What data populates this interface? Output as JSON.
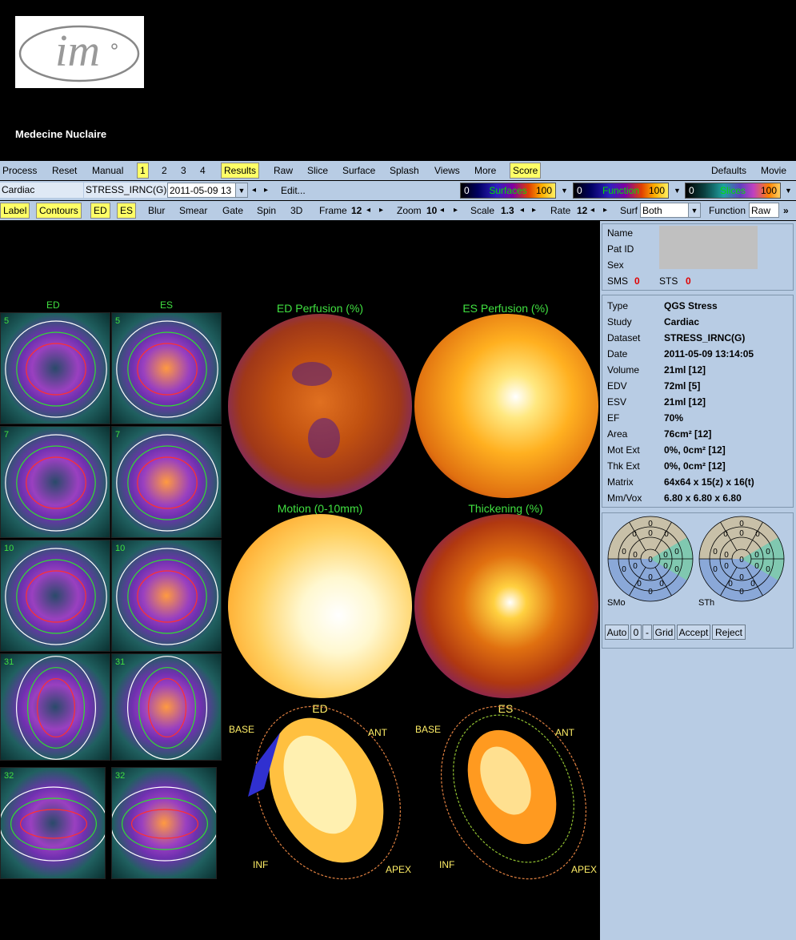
{
  "header": {
    "logo_text": "im",
    "subtitle": "Medecine Nuclaire"
  },
  "toolbar1": {
    "process": "Process",
    "reset": "Reset",
    "manual": "Manual",
    "page1": "1",
    "page2": "2",
    "page3": "3",
    "page4": "4",
    "results": "Results",
    "raw": "Raw",
    "slice": "Slice",
    "surface": "Surface",
    "splash": "Splash",
    "views": "Views",
    "more": "More",
    "score": "Score",
    "defaults": "Defaults",
    "movie": "Movie"
  },
  "toolbar2": {
    "app": "Cardiac",
    "dataset": "STRESS_IRNC(G)",
    "date": "2011-05-09 13",
    "edit": "Edit...",
    "surfaces": {
      "min": "0",
      "name": "Surfaces",
      "max": "100"
    },
    "function": {
      "min": "0",
      "name": "Function",
      "max": "100"
    },
    "slices": {
      "min": "0",
      "name": "Slices",
      "max": "100"
    }
  },
  "toolbar3": {
    "label": "Label",
    "contours": "Contours",
    "ed": "ED",
    "es": "ES",
    "blur": "Blur",
    "smear": "Smear",
    "gate": "Gate",
    "spin": "Spin",
    "threed": "3D",
    "frame_label": "Frame",
    "frame_val": "12",
    "zoom_label": "Zoom",
    "zoom_val": "10",
    "scale_label": "Scale",
    "scale_val": "1.3",
    "rate_label": "Rate",
    "rate_val": "12",
    "surf_label": "Surf",
    "surf_val": "Both",
    "function_label": "Function",
    "function_val": "Raw",
    "more": "»"
  },
  "patient": {
    "name_label": "Name",
    "patid_label": "Pat ID",
    "sex_label": "Sex",
    "sms_label": "SMS",
    "sms_val": "0",
    "sts_label": "STS",
    "sts_val": "0"
  },
  "study": [
    {
      "label": "Type",
      "value": "QGS Stress"
    },
    {
      "label": "Study",
      "value": "Cardiac"
    },
    {
      "label": "Dataset",
      "value": "STRESS_IRNC(G)"
    },
    {
      "label": "Date",
      "value": "2011-05-09 13:14:05"
    },
    {
      "label": "Volume",
      "value": "21ml [12]"
    },
    {
      "label": "EDV",
      "value": "72ml [5]"
    },
    {
      "label": "ESV",
      "value": "21ml [12]"
    },
    {
      "label": "EF",
      "value": "70%"
    },
    {
      "label": "Area",
      "value": "76cm² [12]"
    },
    {
      "label": "Mot Ext",
      "value": "0%, 0cm² [12]"
    },
    {
      "label": "Thk Ext",
      "value": "0%, 0cm² [12]"
    },
    {
      "label": "Matrix",
      "value": "64x64 x 15(z) x 16(t)"
    },
    {
      "label": "Mm/Vox",
      "value": "6.80 x 6.80 x 6.80"
    }
  ],
  "score": {
    "smo_label": "SMo",
    "sth_label": "STh",
    "seg_val": "0",
    "auto": "Auto",
    "zero": "0",
    "minus": "-",
    "grid": "Grid",
    "accept": "Accept",
    "reject": "Reject"
  },
  "views": {
    "ed_col": "ED",
    "es_col": "ES",
    "slice_nums": [
      "5",
      "7",
      "10",
      "31",
      "32"
    ],
    "ed_perf": "ED Perfusion (%)",
    "es_perf": "ES Perfusion (%)",
    "motion": "Motion (0-10mm)",
    "thickening": "Thickening (%)",
    "surf_ed": "ED",
    "surf_es": "ES",
    "base": "BASE",
    "ant": "ANT",
    "inf": "INF",
    "apex": "APEX"
  }
}
